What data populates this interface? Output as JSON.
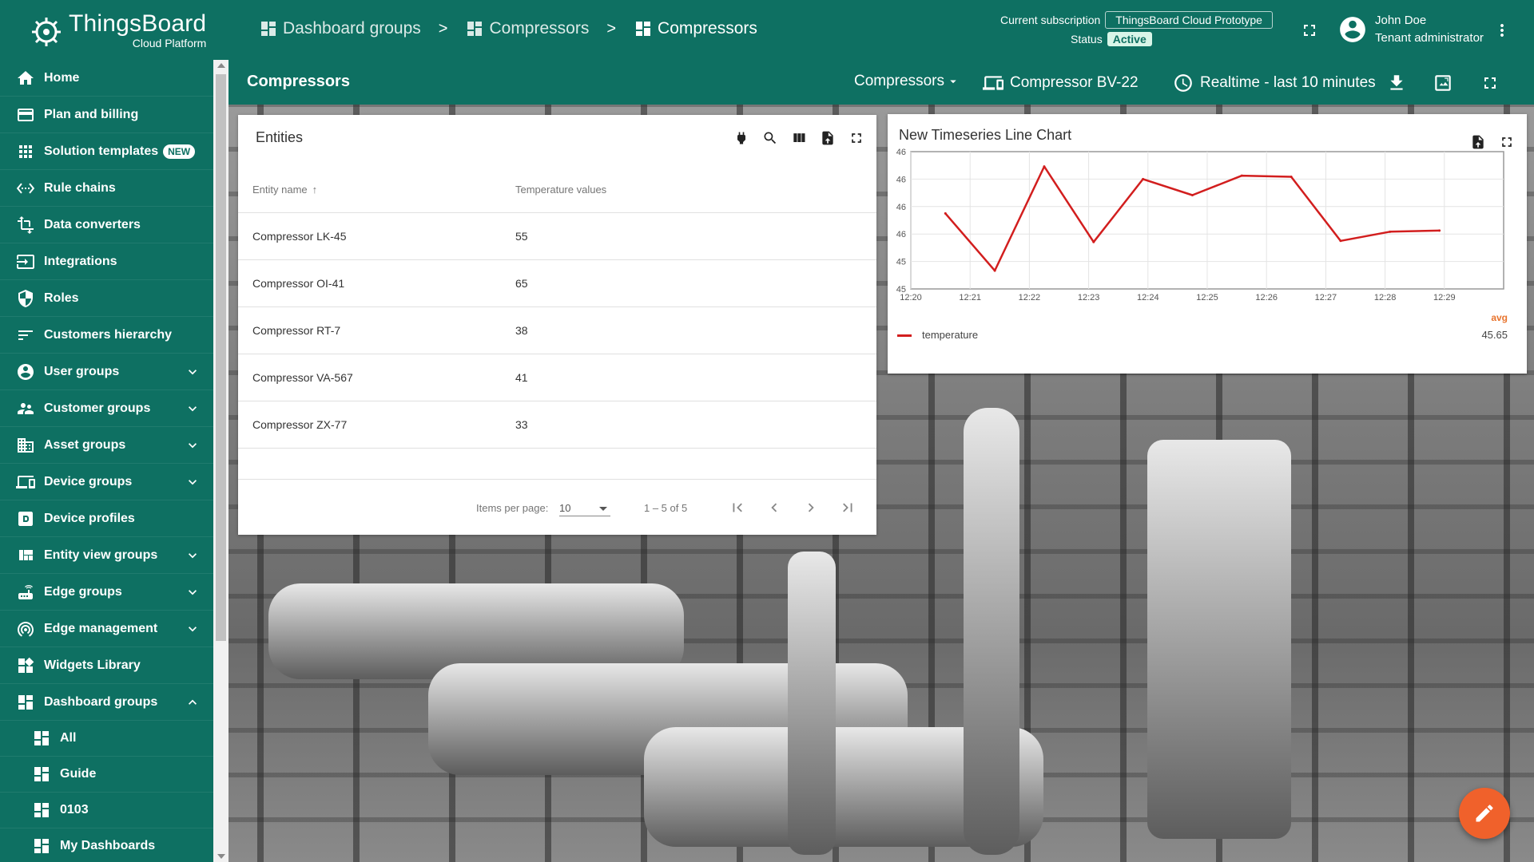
{
  "logo": {
    "title": "ThingsBoard",
    "subtitle": "Cloud Platform"
  },
  "sidebar": {
    "items": [
      {
        "label": "Home",
        "icon": "home-icon"
      },
      {
        "label": "Plan and billing",
        "icon": "credit-card-icon"
      },
      {
        "label": "Solution templates",
        "icon": "apps-grid-icon",
        "badge": "NEW"
      },
      {
        "label": "Rule chains",
        "icon": "settings-ethernet-icon"
      },
      {
        "label": "Data converters",
        "icon": "transform-icon"
      },
      {
        "label": "Integrations",
        "icon": "input-icon"
      },
      {
        "label": "Roles",
        "icon": "shield-icon"
      },
      {
        "label": "Customers hierarchy",
        "icon": "sort-lines-icon"
      },
      {
        "label": "User groups",
        "icon": "account-circle-icon",
        "expand": true
      },
      {
        "label": "Customer groups",
        "icon": "supervisor-icon",
        "expand": true
      },
      {
        "label": "Asset groups",
        "icon": "domain-icon",
        "expand": true
      },
      {
        "label": "Device groups",
        "icon": "devices-icon",
        "expand": true
      },
      {
        "label": "Device profiles",
        "icon": "device-profile-icon"
      },
      {
        "label": "Entity view groups",
        "icon": "view-quilt-icon",
        "expand": true
      },
      {
        "label": "Edge groups",
        "icon": "router-icon",
        "expand": true
      },
      {
        "label": "Edge management",
        "icon": "wifi-tethering-icon",
        "expand": true
      },
      {
        "label": "Widgets Library",
        "icon": "widgets-icon"
      },
      {
        "label": "Dashboard groups",
        "icon": "dashboard-icon",
        "expanded": true
      }
    ],
    "sub_items": [
      {
        "label": "All",
        "icon": "dashboard-icon"
      },
      {
        "label": "Guide",
        "icon": "dashboard-icon"
      },
      {
        "label": "0103",
        "icon": "dashboard-icon"
      },
      {
        "label": "My Dashboards",
        "icon": "dashboard-icon"
      }
    ]
  },
  "header": {
    "breadcrumbs": [
      "Dashboard groups",
      "Compressors",
      "Compressors"
    ],
    "separator": ">",
    "subscription_label": "Current subscription",
    "subscription_plan": "ThingsBoard Cloud Prototype",
    "status_label": "Status",
    "status_value": "Active",
    "user_name": "John Doe",
    "user_role": "Tenant administrator"
  },
  "toolbar": {
    "title": "Compressors",
    "state_select": "Compressors",
    "entity": "Compressor BV-22",
    "timewindow": "Realtime - last 10 minutes"
  },
  "entities_widget": {
    "title": "Entities",
    "columns": [
      "Entity name",
      "Temperature values"
    ],
    "rows": [
      [
        "Compressor LK-45",
        "55"
      ],
      [
        "Compressor OI-41",
        "65"
      ],
      [
        "Compressor RT-7",
        "38"
      ],
      [
        "Compressor VA-567",
        "41"
      ],
      [
        "Compressor ZX-77",
        "33"
      ]
    ],
    "items_per_page_label": "Items per page:",
    "items_per_page": "10",
    "range": "1 – 5 of 5"
  },
  "chart_widget": {
    "title": "New Timeseries Line Chart",
    "legend_header": "avg",
    "legend_name": "temperature",
    "legend_value": "45.65"
  },
  "colors": {
    "primary": "#0e7062",
    "series": "#d21e1e",
    "fab": "#f0612b",
    "avg": "#e8742e"
  },
  "chart_data": {
    "type": "line",
    "x": [
      "12:20:35",
      "12:21:25",
      "12:22:15",
      "12:23:05",
      "12:23:55",
      "12:24:45",
      "12:25:35",
      "12:26:25",
      "12:27:15",
      "12:28:05",
      "12:28:55"
    ],
    "series": [
      {
        "name": "temperature",
        "values": [
          45.56,
          45.06,
          45.97,
          45.31,
          45.86,
          45.72,
          45.89,
          45.88,
          45.32,
          45.4,
          45.41
        ]
      }
    ],
    "x_ticks": [
      "12:20",
      "12:21",
      "12:22",
      "12:23",
      "12:24",
      "12:25",
      "12:26",
      "12:27",
      "12:28",
      "12:29"
    ],
    "y_ticks": [
      "45",
      "45",
      "46",
      "46",
      "46",
      "46"
    ],
    "ylim": [
      44.9,
      46.1
    ],
    "grid": true,
    "legend": "bottom"
  }
}
